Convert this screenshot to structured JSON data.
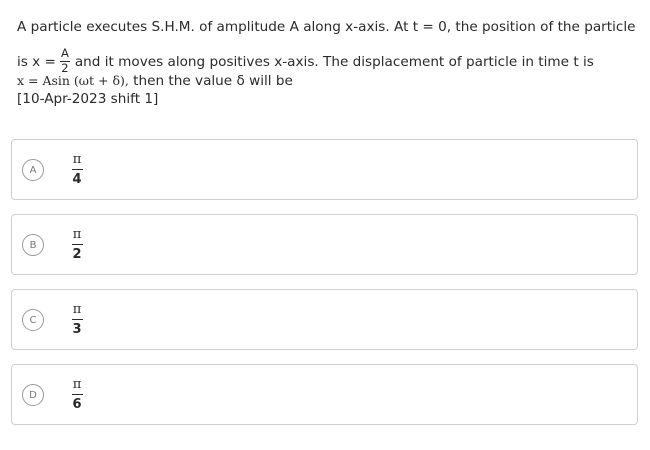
{
  "question": {
    "line1": "A particle executes S.H.M. of amplitude A along x-axis. At t = 0, the position of the particle",
    "line2_prefix": "is x =",
    "frac_num": "A",
    "frac_den": "2",
    "line2_suffix": "and it moves along positives x-axis. The displacement of particle in time t is",
    "line3_eq": "x = Asin (ωt + δ),",
    "line3_suffix": " then the value δ will be",
    "line4": "[10-Apr-2023 shift 1]"
  },
  "options": [
    {
      "letter": "A",
      "num": "π",
      "den": "4"
    },
    {
      "letter": "B",
      "num": "π",
      "den": "2"
    },
    {
      "letter": "C",
      "num": "π",
      "den": "3"
    },
    {
      "letter": "D",
      "num": "π",
      "den": "6"
    }
  ]
}
